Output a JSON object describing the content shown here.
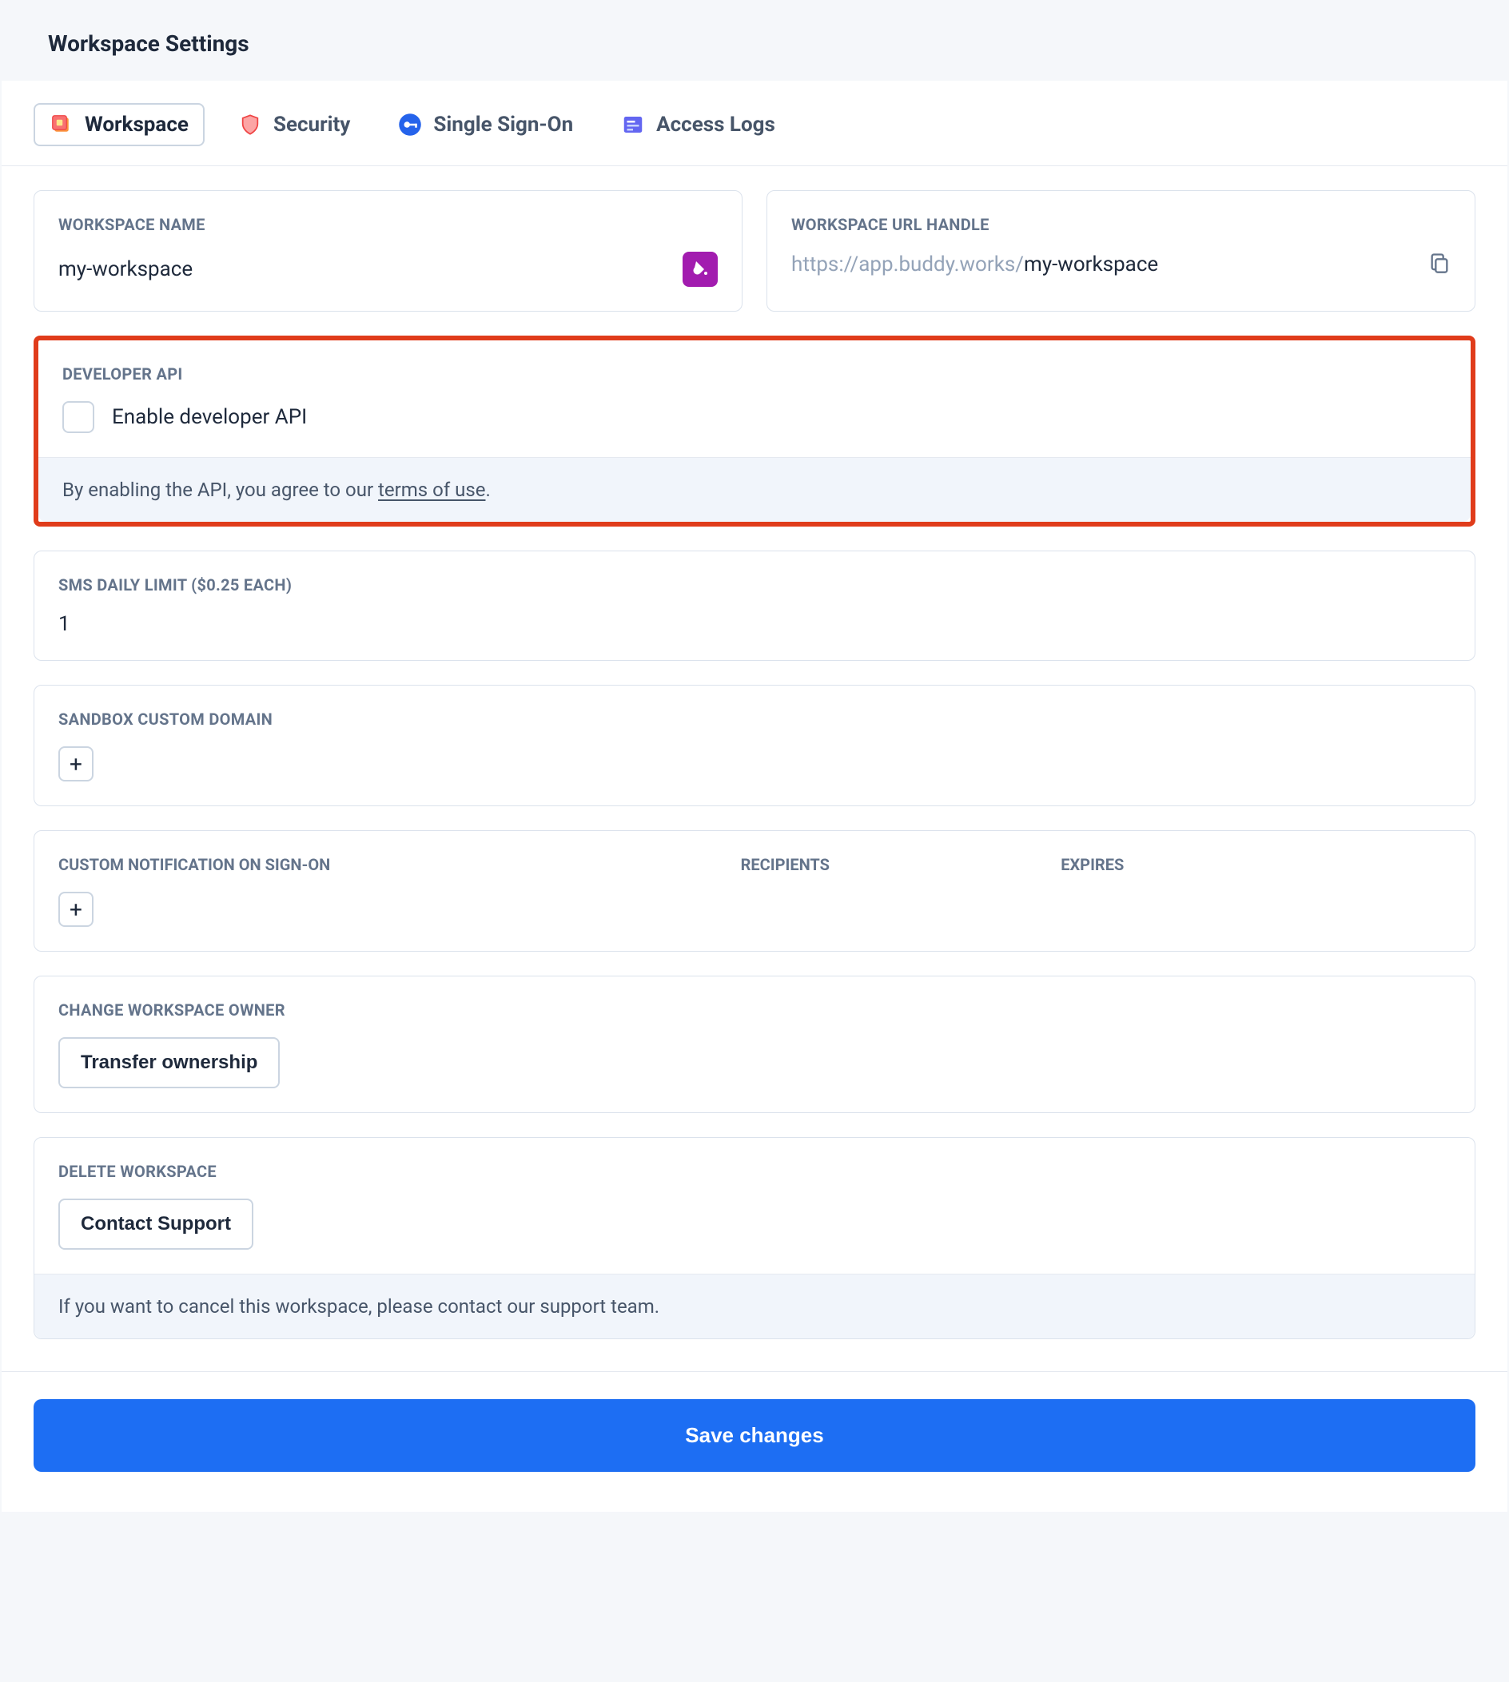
{
  "header": {
    "title": "Workspace Settings"
  },
  "tabs": {
    "workspace": "Workspace",
    "security": "Security",
    "sso": "Single Sign-On",
    "accessLogs": "Access Logs"
  },
  "workspaceName": {
    "label": "WORKSPACE NAME",
    "value": "my-workspace"
  },
  "workspaceUrl": {
    "label": "WORKSPACE URL HANDLE",
    "prefix": "https://app.buddy.works/",
    "handle": "my-workspace"
  },
  "developerApi": {
    "label": "DEVELOPER API",
    "checkboxLabel": "Enable developer API",
    "footerPrefix": "By enabling the API, you agree to our ",
    "footerLink": "terms of use",
    "footerSuffix": "."
  },
  "smsLimit": {
    "label": "SMS DAILY LIMIT ($0.25 EACH)",
    "value": "1"
  },
  "sandbox": {
    "label": "SANDBOX CUSTOM DOMAIN"
  },
  "notifications": {
    "colA": "CUSTOM NOTIFICATION ON SIGN-ON",
    "colB": "RECIPIENTS",
    "colC": "EXPIRES"
  },
  "changeOwner": {
    "label": "CHANGE WORKSPACE OWNER",
    "button": "Transfer ownership"
  },
  "deleteWorkspace": {
    "label": "DELETE WORKSPACE",
    "button": "Contact Support",
    "footer": "If you want to cancel this workspace, please contact our support team."
  },
  "actions": {
    "save": "Save changes"
  }
}
